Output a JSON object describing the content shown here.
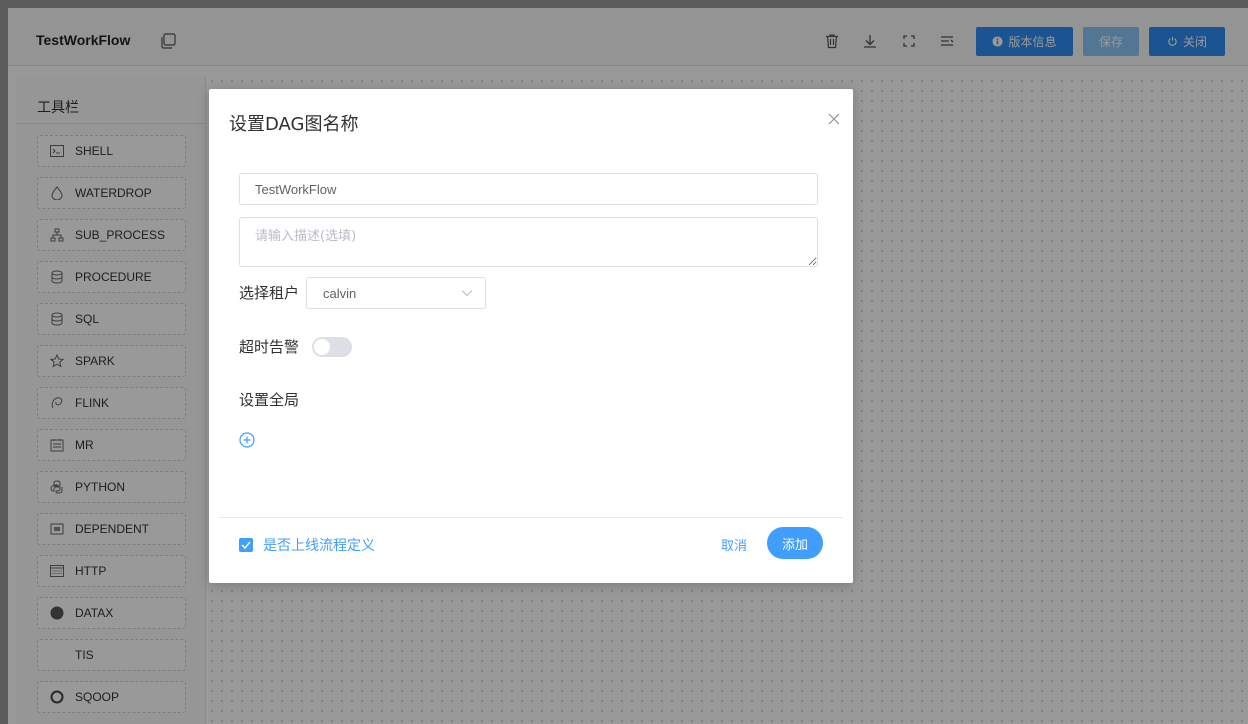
{
  "header": {
    "workflow_title": "TestWorkFlow",
    "version_button": "版本信息",
    "save_button": "保存",
    "close_button": "关闭"
  },
  "sidebar": {
    "title": "工具栏",
    "items": [
      {
        "label": "SHELL",
        "icon": "terminal-icon"
      },
      {
        "label": "WATERDROP",
        "icon": "waterdrop-icon"
      },
      {
        "label": "SUB_PROCESS",
        "icon": "sub-process-icon"
      },
      {
        "label": "PROCEDURE",
        "icon": "database-icon"
      },
      {
        "label": "SQL",
        "icon": "sql-icon"
      },
      {
        "label": "SPARK",
        "icon": "star-icon"
      },
      {
        "label": "FLINK",
        "icon": "flink-icon"
      },
      {
        "label": "MR",
        "icon": "mr-icon"
      },
      {
        "label": "PYTHON",
        "icon": "python-icon"
      },
      {
        "label": "DEPENDENT",
        "icon": "dependent-icon"
      },
      {
        "label": "HTTP",
        "icon": "http-icon"
      },
      {
        "label": "DATAX",
        "icon": "datax-icon"
      },
      {
        "label": "TIS",
        "icon": ""
      },
      {
        "label": "SQOOP",
        "icon": "sqoop-icon"
      }
    ]
  },
  "modal": {
    "title": "设置DAG图名称",
    "name_value": "TestWorkFlow",
    "desc_placeholder": "请输入描述(选填)",
    "tenant_label": "选择租户",
    "tenant_value": "calvin",
    "timeout_label": "超时告警",
    "timeout_enabled": false,
    "global_label": "设置全局",
    "online_label": "是否上线流程定义",
    "online_checked": true,
    "cancel_label": "取消",
    "add_label": "添加"
  },
  "colors": {
    "primary": "#2d8cf0",
    "accent": "#409eff",
    "save_disabled": "#8cc5f8"
  }
}
